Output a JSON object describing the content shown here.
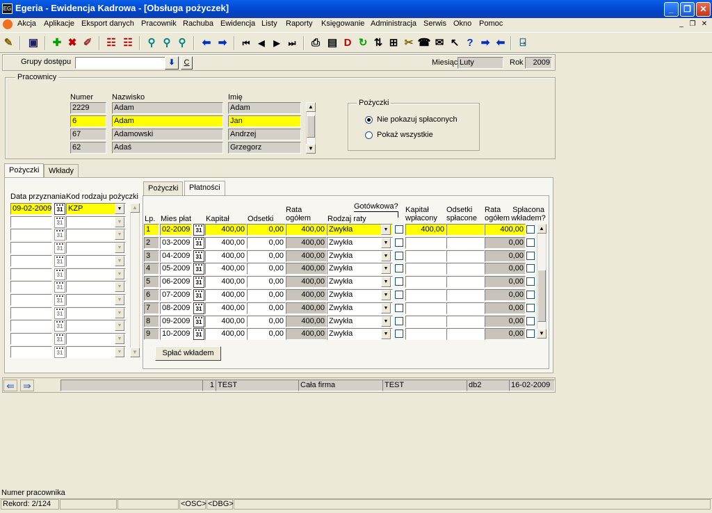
{
  "window": {
    "title": "Egeria - Ewidencja Kadrowa - [Obsługa pożyczek]",
    "app_icon": "EG"
  },
  "menu": [
    "Akcja",
    "Aplikacje",
    "Eksport danych",
    "Pracownik",
    "Rachuba",
    "Ewidencja",
    "Listy",
    "Raporty",
    "Księgowanie",
    "Administracja",
    "Serwis",
    "Okno",
    "Pomoc"
  ],
  "filter": {
    "groups_label": "Grupy dostępu",
    "groups_value": "",
    "clear_label": "C",
    "month_label": "Miesiąc",
    "month_value": "Luty",
    "year_label": "Rok",
    "year_value": "2009"
  },
  "employees": {
    "group_title": "Pracownicy",
    "col_number": "Numer",
    "col_surname": "Nazwisko",
    "col_name": "Imię",
    "rows": [
      {
        "number": "2229",
        "surname": "Adam",
        "name": "Adam"
      },
      {
        "number": "6",
        "surname": "Adam",
        "name": "Jan"
      },
      {
        "number": "67",
        "surname": "Adamowski",
        "name": "Andrzej"
      },
      {
        "number": "62",
        "surname": "Adaś",
        "name": "Grzegorz"
      }
    ],
    "selected_index": 1
  },
  "loans_filter": {
    "title": "Pożyczki",
    "option1": "Nie pokazuj spłaconych",
    "option2": "Pokaż wszystkie",
    "selected": 1
  },
  "outer_tabs": [
    "Pożyczki",
    "Wkłady"
  ],
  "left_grid": {
    "col_date": "Data przyznania",
    "col_kind": "Kod rodzaju pożyczki",
    "first_date": "09-02-2009",
    "first_kind": "KZP"
  },
  "inner_tabs": [
    "Pożyczki",
    "Płatności"
  ],
  "payments": {
    "headers": {
      "lp": "Lp.",
      "month": "Mies płat",
      "capital": "Kapitał",
      "interest": "Odsetki",
      "rate_total": "Rata ogółem",
      "rate_kind": "Rodzaj raty",
      "cash": "Gotówkowa?",
      "capital_paid": "Kapitał wpłacony",
      "interest_paid": "Odsetki spłacone",
      "rate_total2": "Rata ogółem",
      "paid_deposit": "Spłacona wkładem?"
    },
    "rows": [
      {
        "lp": "1",
        "month": "02-2009",
        "capital": "400,00",
        "interest": "0,00",
        "rate_total": "400,00",
        "kind": "Zwykła",
        "capital_paid": "400,00",
        "interest_paid": "",
        "rate_total2": "400,00"
      },
      {
        "lp": "2",
        "month": "03-2009",
        "capital": "400,00",
        "interest": "0,00",
        "rate_total": "400,00",
        "kind": "Zwykła",
        "capital_paid": "",
        "interest_paid": "",
        "rate_total2": "0,00"
      },
      {
        "lp": "3",
        "month": "04-2009",
        "capital": "400,00",
        "interest": "0,00",
        "rate_total": "400,00",
        "kind": "Zwykła",
        "capital_paid": "",
        "interest_paid": "",
        "rate_total2": "0,00"
      },
      {
        "lp": "4",
        "month": "05-2009",
        "capital": "400,00",
        "interest": "0,00",
        "rate_total": "400,00",
        "kind": "Zwykła",
        "capital_paid": "",
        "interest_paid": "",
        "rate_total2": "0,00"
      },
      {
        "lp": "5",
        "month": "06-2009",
        "capital": "400,00",
        "interest": "0,00",
        "rate_total": "400,00",
        "kind": "Zwykła",
        "capital_paid": "",
        "interest_paid": "",
        "rate_total2": "0,00"
      },
      {
        "lp": "6",
        "month": "07-2009",
        "capital": "400,00",
        "interest": "0,00",
        "rate_total": "400,00",
        "kind": "Zwykła",
        "capital_paid": "",
        "interest_paid": "",
        "rate_total2": "0,00"
      },
      {
        "lp": "7",
        "month": "08-2009",
        "capital": "400,00",
        "interest": "0,00",
        "rate_total": "400,00",
        "kind": "Zwykła",
        "capital_paid": "",
        "interest_paid": "",
        "rate_total2": "0,00"
      },
      {
        "lp": "8",
        "month": "09-2009",
        "capital": "400,00",
        "interest": "0,00",
        "rate_total": "400,00",
        "kind": "Zwykła",
        "capital_paid": "",
        "interest_paid": "",
        "rate_total2": "0,00"
      },
      {
        "lp": "9",
        "month": "10-2009",
        "capital": "400,00",
        "interest": "0,00",
        "rate_total": "400,00",
        "kind": "Zwykła",
        "capital_paid": "",
        "interest_paid": "",
        "rate_total2": "0,00"
      }
    ],
    "pay_button": "Spłać wkładem"
  },
  "form_status": {
    "count": "1",
    "user": "TEST",
    "scope": "Cała firma",
    "user2": "TEST",
    "db": "db2",
    "date": "16-02-2009"
  },
  "statusbar": {
    "hint": "Numer pracownika",
    "record": "Rekord: 2/124",
    "osc": "<OSC>",
    "dbg": "<DBG>"
  },
  "calendar_glyph": "31"
}
